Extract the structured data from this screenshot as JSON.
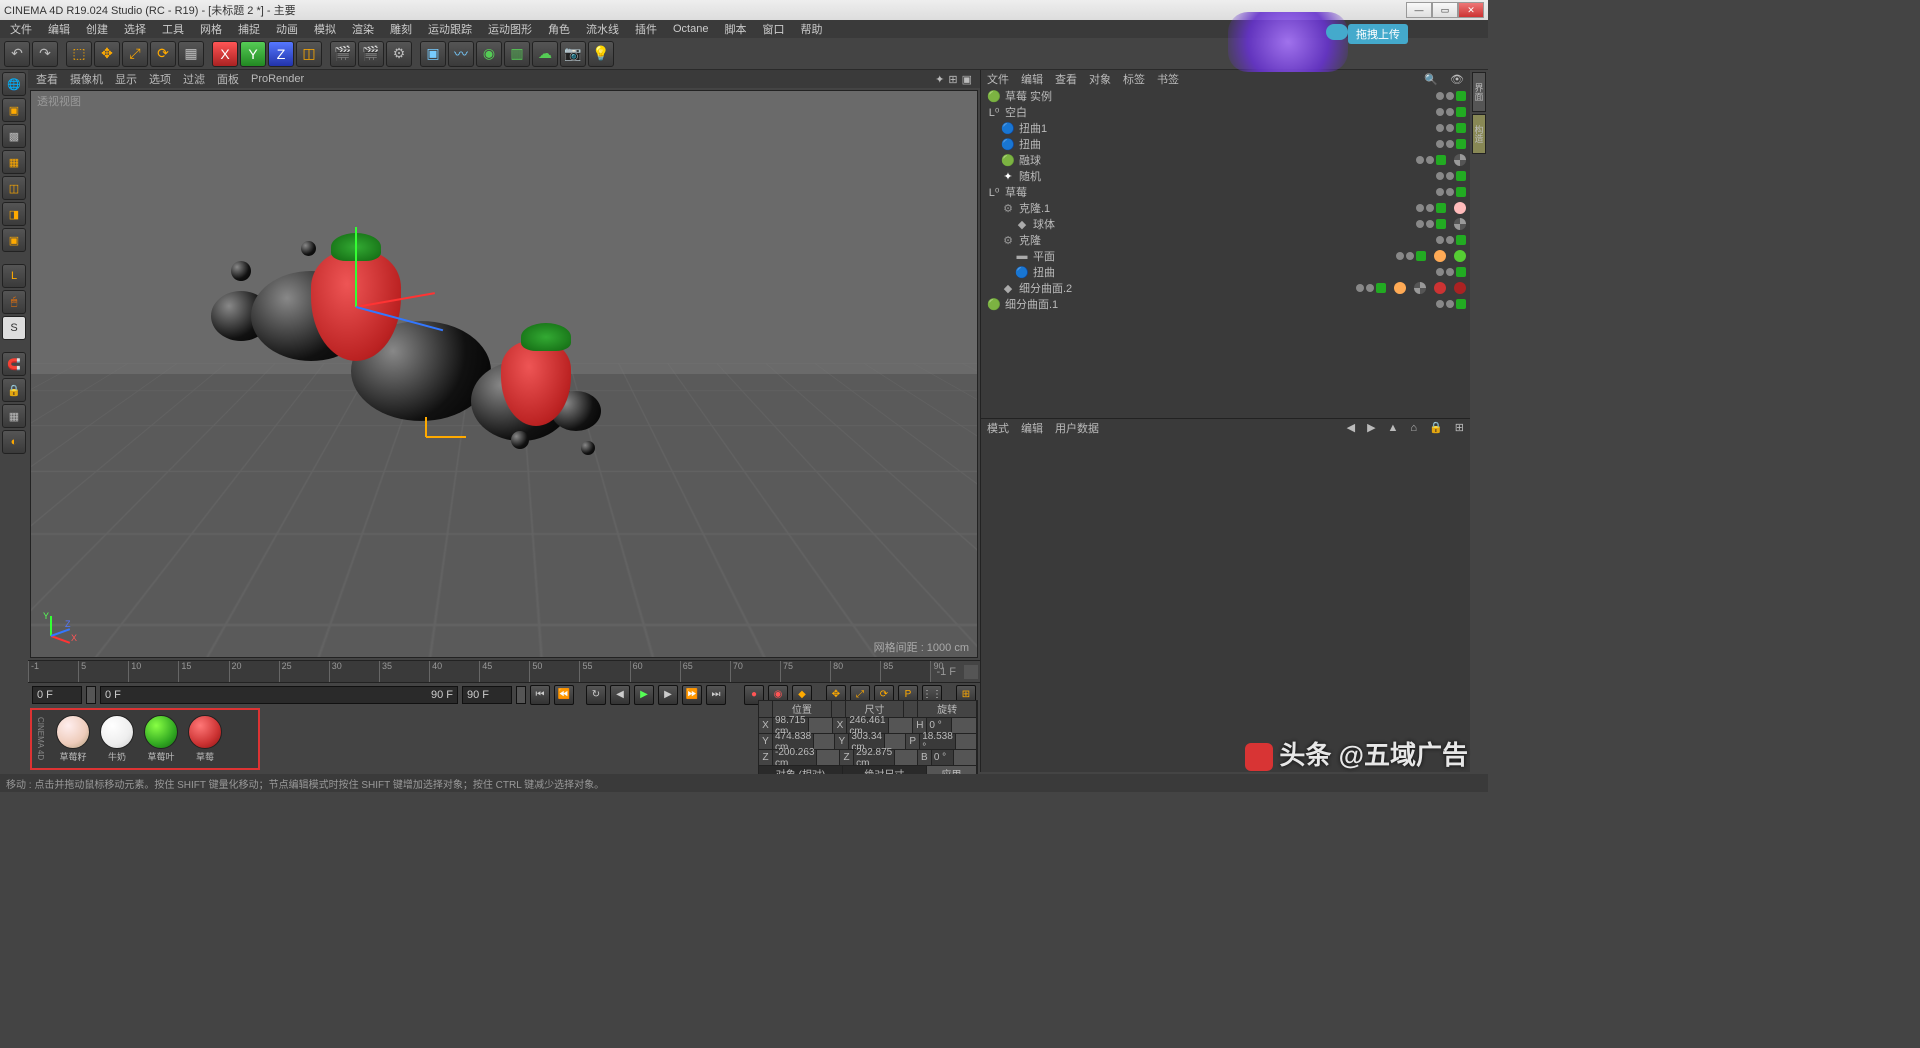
{
  "window": {
    "title": "CINEMA 4D R19.024 Studio (RC - R19) - [未标题 2 *] - 主要"
  },
  "menus": [
    "文件",
    "编辑",
    "创建",
    "选择",
    "工具",
    "网格",
    "捕捉",
    "动画",
    "模拟",
    "渲染",
    "雕刻",
    "运动跟踪",
    "运动图形",
    "角色",
    "流水线",
    "插件",
    "Octane",
    "脚本",
    "窗口",
    "帮助"
  ],
  "viewport_menus": [
    "查看",
    "摄像机",
    "显示",
    "选项",
    "过滤",
    "面板",
    "ProRender"
  ],
  "viewport": {
    "label": "透视视图",
    "grid_info": "网格间距 : 1000 cm"
  },
  "obj_panel_menus": [
    "文件",
    "编辑",
    "查看",
    "对象",
    "标签",
    "书签"
  ],
  "attr_panel_menus": [
    "模式",
    "编辑",
    "用户数据"
  ],
  "objects": [
    {
      "indent": 0,
      "icon": "🟢",
      "name": "草莓 实例",
      "color": "#3c3"
    },
    {
      "indent": 0,
      "icon": "L⁰",
      "name": "空白",
      "color": "#bbb"
    },
    {
      "indent": 1,
      "icon": "🔵",
      "name": "扭曲1",
      "color": "#77f"
    },
    {
      "indent": 1,
      "icon": "🔵",
      "name": "扭曲",
      "color": "#77f"
    },
    {
      "indent": 1,
      "icon": "🟢",
      "name": "融球",
      "color": "#3c3",
      "tags": [
        "checker"
      ]
    },
    {
      "indent": 1,
      "icon": "✦",
      "name": "随机",
      "color": "#fff"
    },
    {
      "indent": 0,
      "icon": "L⁰",
      "name": "草莓",
      "color": "#bbb"
    },
    {
      "indent": 1,
      "icon": "⚙",
      "name": "克隆.1",
      "color": "#999",
      "tags": [
        "pink"
      ]
    },
    {
      "indent": 2,
      "icon": "◆",
      "name": "球体",
      "color": "#aaa",
      "tags": [
        "checker"
      ]
    },
    {
      "indent": 1,
      "icon": "⚙",
      "name": "克隆",
      "color": "#999"
    },
    {
      "indent": 2,
      "icon": "▬",
      "name": "平面",
      "color": "#aaa",
      "tags": [
        "orange",
        "green"
      ]
    },
    {
      "indent": 2,
      "icon": "🔵",
      "name": "扭曲",
      "color": "#77f"
    },
    {
      "indent": 1,
      "icon": "◆",
      "name": "细分曲面.2",
      "color": "#aaa",
      "tags": [
        "orange",
        "checker",
        "red",
        "red2"
      ]
    },
    {
      "indent": 0,
      "icon": "🟢",
      "name": "细分曲面.1",
      "color": "#3c3"
    }
  ],
  "materials": [
    {
      "name": "草莓籽",
      "color": "radial-gradient(circle at 35% 30%,#fee,#ecb 60%,#a97)"
    },
    {
      "name": "牛奶",
      "color": "radial-gradient(circle at 35% 30%,#fff,#eee 60%,#ccc)"
    },
    {
      "name": "草莓叶",
      "color": "radial-gradient(circle at 35% 30%,#8f4,#3a2 60%,#161)"
    },
    {
      "name": "草莓",
      "color": "radial-gradient(circle at 35% 30%,#f77,#c33 60%,#811)"
    }
  ],
  "timeline": {
    "start": "0 F",
    "end": "90 F",
    "start2": "0 F",
    "end2": "90 F",
    "endlabel": "-1 F",
    "ticks": [
      -1,
      5,
      10,
      15,
      20,
      25,
      30,
      35,
      40,
      45,
      50,
      55,
      60,
      65,
      70,
      75,
      80,
      85,
      90
    ]
  },
  "coords": {
    "hdr": [
      "位置",
      "尺寸",
      "旋转"
    ],
    "rows": [
      {
        "l": "X",
        "p": "98.715 cm",
        "s": "246.461 cm",
        "r": "0 °",
        "rl": "H"
      },
      {
        "l": "Y",
        "p": "474.838 cm",
        "s": "303.34 cm",
        "r": "18.538 °",
        "rl": "P"
      },
      {
        "l": "Z",
        "p": "-200.263 cm",
        "s": "292.875 cm",
        "r": "0 °",
        "rl": "B"
      }
    ],
    "mode1": "对象 (相对)",
    "mode2": "绝对尺寸",
    "apply": "应用"
  },
  "status": "移动 : 点击并拖动鼠标移动元素。按住 SHIFT 键量化移动；节点编辑模式时按住 SHIFT 键增加选择对象；按住 CTRL 键减少选择对象。",
  "upload_label": "拖拽上传",
  "watermark": "头条 @五域广告",
  "right_tabs": [
    "界面",
    "构造"
  ]
}
